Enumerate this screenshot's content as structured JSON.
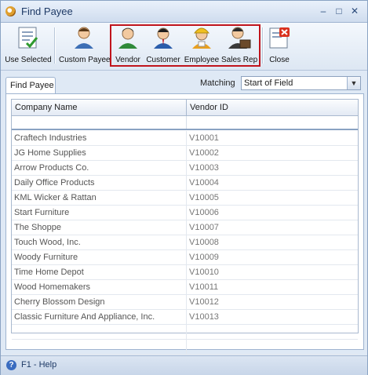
{
  "window": {
    "title": "Find Payee"
  },
  "title_controls": {
    "minimize": "–",
    "maximize": "□",
    "close": "✕"
  },
  "toolbar": {
    "buttons": [
      {
        "label": "Use Selected",
        "icon": "use-selected-icon"
      },
      {
        "label": "Custom Payee",
        "icon": "custom-payee-icon"
      },
      {
        "label": "Vendor",
        "icon": "vendor-icon"
      },
      {
        "label": "Customer",
        "icon": "customer-icon"
      },
      {
        "label": "Employee",
        "icon": "employee-icon"
      },
      {
        "label": "Sales Rep",
        "icon": "sales-rep-icon"
      },
      {
        "label": "Close",
        "icon": "close-icon"
      }
    ],
    "highlight_color": "#c0141c"
  },
  "tab": {
    "label": "Find Payee"
  },
  "matching": {
    "label": "Matching",
    "selected": "Start of Field"
  },
  "grid": {
    "columns": [
      "Company Name",
      "Vendor ID"
    ],
    "rows": [
      {
        "company": "Craftech Industries",
        "vendor_id": "V10001"
      },
      {
        "company": "JG Home Supplies",
        "vendor_id": "V10002"
      },
      {
        "company": "Arrow Products Co.",
        "vendor_id": "V10003"
      },
      {
        "company": "Daily Office Products",
        "vendor_id": "V10004"
      },
      {
        "company": "KML Wicker & Rattan",
        "vendor_id": "V10005"
      },
      {
        "company": "Start Furniture",
        "vendor_id": "V10006"
      },
      {
        "company": "The Shoppe",
        "vendor_id": "V10007"
      },
      {
        "company": "Touch Wood, Inc.",
        "vendor_id": "V10008"
      },
      {
        "company": "Woody Furniture",
        "vendor_id": "V10009"
      },
      {
        "company": "Time Home Depot",
        "vendor_id": "V10010"
      },
      {
        "company": "Wood Homemakers",
        "vendor_id": "V10011"
      },
      {
        "company": "Cherry Blossom Design",
        "vendor_id": "V10012"
      },
      {
        "company": "Classic Furniture And Appliance, Inc.",
        "vendor_id": "V10013"
      }
    ]
  },
  "status": {
    "help": "F1 - Help"
  }
}
